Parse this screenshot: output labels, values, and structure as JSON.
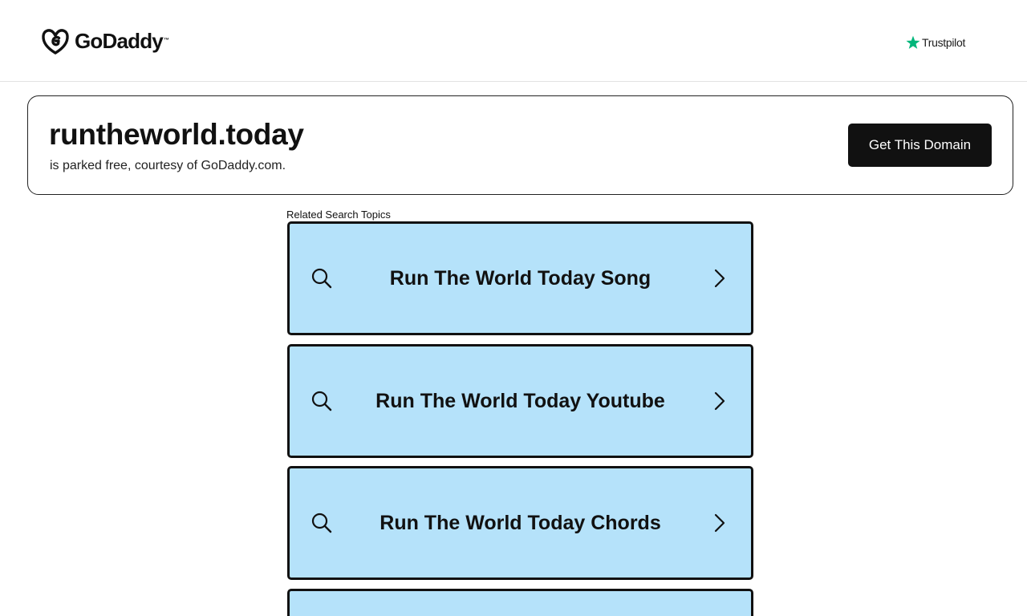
{
  "header": {
    "brand": "GoDaddy",
    "brand_tm": "™",
    "logo_icon": "godaddy-logo-icon",
    "trustpilot_label": "Trustpilot",
    "trustpilot_icon": "star-icon",
    "trustpilot_color": "#00b67a"
  },
  "domain": {
    "name": "runtheworld.today",
    "subtitle": "is parked free, courtesy of GoDaddy.com.",
    "cta_label": "Get This Domain"
  },
  "related": {
    "heading": "Related Search Topics",
    "card_color": "#b5e2fa",
    "items": [
      {
        "label": "Run The World Today Song"
      },
      {
        "label": "Run The World Today Youtube"
      },
      {
        "label": "Run The World Today Chords"
      },
      {
        "label": ""
      }
    ]
  }
}
